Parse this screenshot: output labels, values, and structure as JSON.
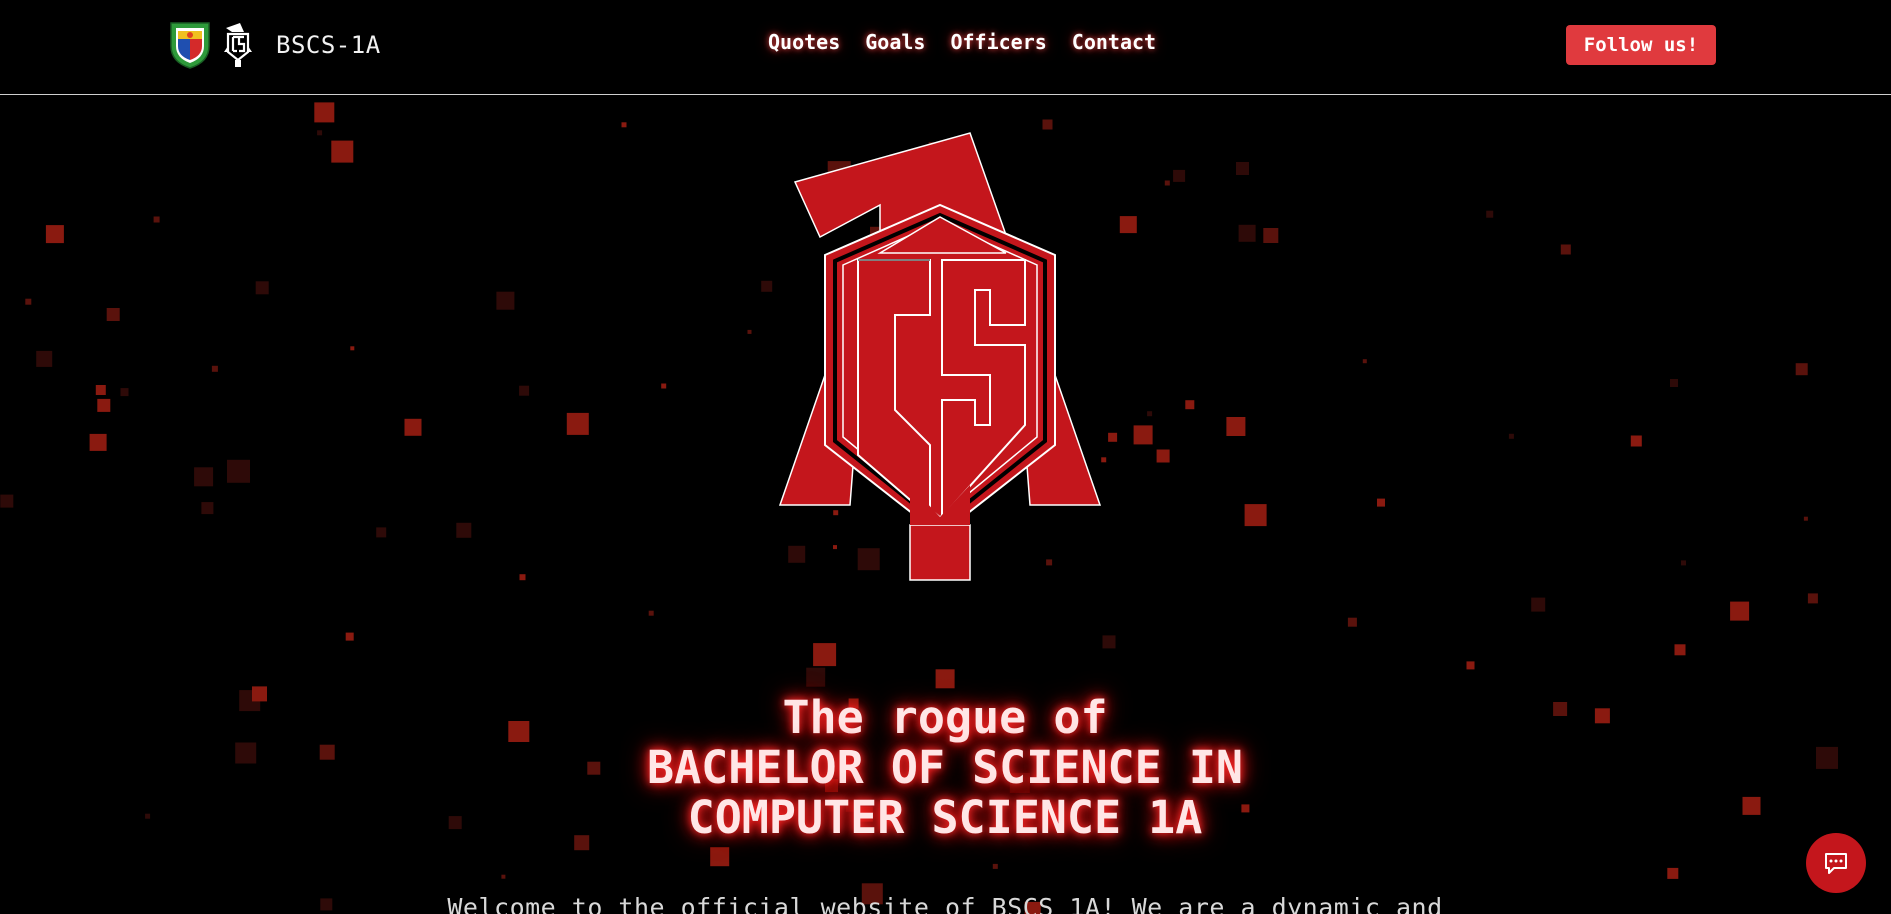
{
  "header": {
    "site_name": "BSCS-1A",
    "nav": [
      "Quotes",
      "Goals",
      "Officers",
      "Contact"
    ],
    "follow_label": "Follow us!"
  },
  "hero": {
    "title_lines": [
      "The rogue of",
      "BACHELOR OF SCIENCE IN",
      "COMPUTER SCIENCE 1A"
    ],
    "description": "Welcome to the official website of BSCS 1A! We are a dynamic and"
  },
  "icons": {
    "seal": "university-seal-icon",
    "cs": "cs-logo-icon",
    "chat": "chat-bubble-icon"
  },
  "colors": {
    "accent": "#e03a3e",
    "logo_red": "#c4161c",
    "background": "#000000"
  }
}
